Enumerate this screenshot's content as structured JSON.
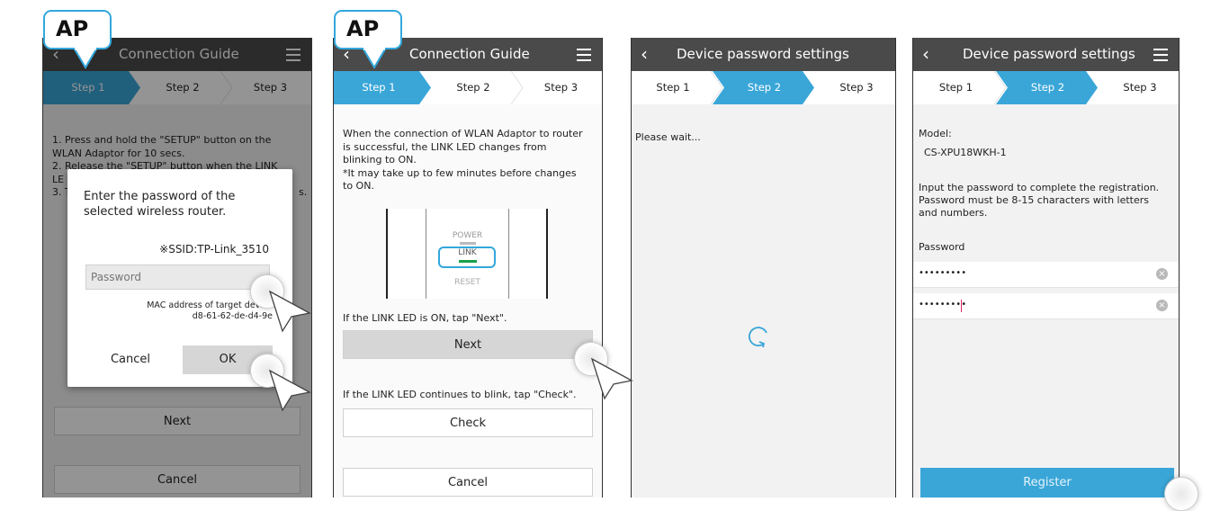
{
  "screens": [
    {
      "badge": "AP",
      "title": "Connection Guide",
      "steps": [
        "Step 1",
        "Step 2",
        "Step 3"
      ],
      "instructions": [
        "1. Press and hold the \"SETUP\" button on the",
        "WLAN Adaptor for 10 secs.",
        "2. Release the \"SETUP\" button when the LINK",
        "LE",
        "3. T"
      ],
      "instr_tail": "s.",
      "dialog": {
        "prompt_line1": "Enter the password of the",
        "prompt_line2": "selected wireless router.",
        "ssid": "※SSID:TP-Link_3510",
        "password_placeholder": "Password",
        "mac_label": "MAC address of target device",
        "mac_value": "d8-61-62-de-d4-9e",
        "cancel": "Cancel",
        "ok": "OK"
      },
      "next": "Next",
      "cancel": "Cancel"
    },
    {
      "badge": "AP",
      "title": "Connection Guide",
      "steps": [
        "Step 1",
        "Step 2",
        "Step 3"
      ],
      "instructions": [
        "When the connection of WLAN Adaptor to router",
        "is successful, the LINK LED changes from",
        "blinking to ON.",
        "*It may take up to few minutes before changes",
        "to ON."
      ],
      "led_labels": {
        "power": "POWER",
        "link": "LINK",
        "reset": "RESET"
      },
      "on_text": "If the LINK LED is ON, tap \"Next\".",
      "next": "Next",
      "blink_text": "If the LINK LED continues to blink,  tap \"Check\".",
      "check": "Check",
      "cancel": "Cancel"
    },
    {
      "title": "Device password settings",
      "steps": [
        "Step 1",
        "Step 2",
        "Step 3"
      ],
      "wait": "Please wait..."
    },
    {
      "title": "Device password settings",
      "steps": [
        "Step 1",
        "Step 2",
        "Step 3"
      ],
      "model_label": "Model:",
      "model_value": "CS-XPU18WKH-1",
      "desc": [
        "Input the password to complete the registration.",
        "Password must be 8-15 characters with letters",
        "and numbers."
      ],
      "password_label": "Password",
      "password_value": "•••••••••",
      "confirm_value": "•••••••••",
      "register": "Register"
    }
  ],
  "colors": {
    "accent": "#3aa6d8",
    "topbar": "#4a4a4a",
    "badge_border": "#33a7dc"
  }
}
